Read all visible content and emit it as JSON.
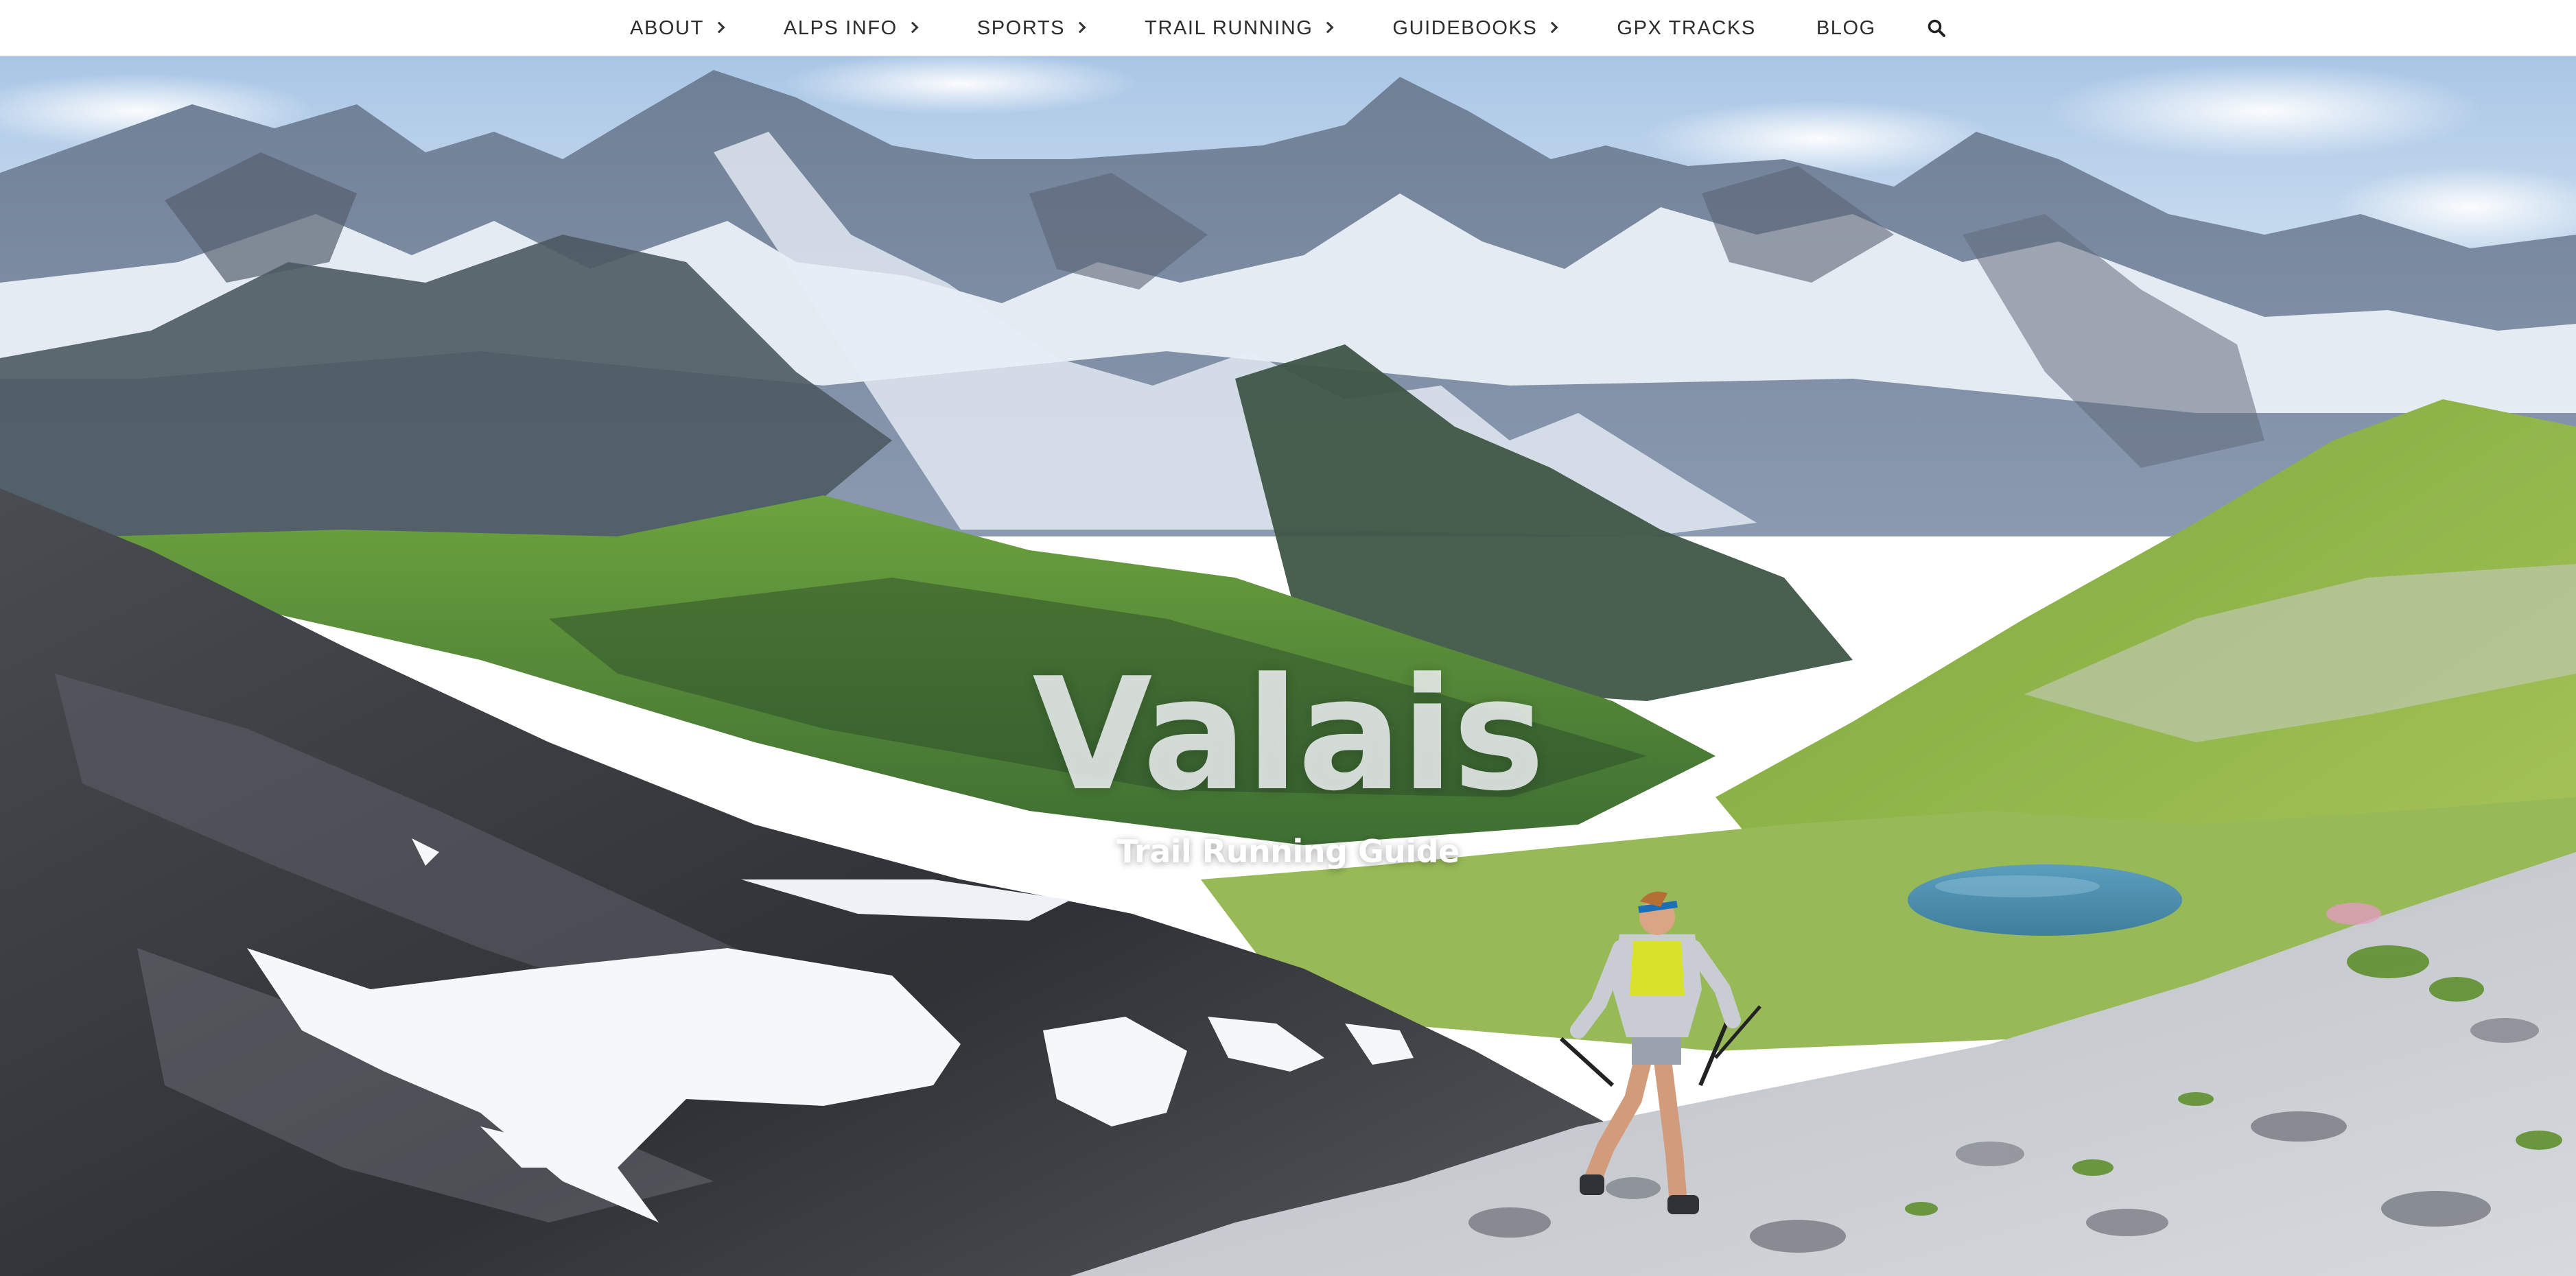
{
  "nav": {
    "items": [
      {
        "label": "ABOUT",
        "has_submenu": true
      },
      {
        "label": "ALPS INFO",
        "has_submenu": true
      },
      {
        "label": "SPORTS",
        "has_submenu": true
      },
      {
        "label": "TRAIL RUNNING",
        "has_submenu": true
      },
      {
        "label": "GUIDEBOOKS",
        "has_submenu": true
      },
      {
        "label": "GPX TRACKS",
        "has_submenu": false
      },
      {
        "label": "BLOG",
        "has_submenu": false
      }
    ],
    "search_icon": "search-icon",
    "text_color": "#2d2d2d",
    "background": "#ffffff"
  },
  "hero": {
    "title": "Valais",
    "subtitle": "Trail Running Guide",
    "image_subject": "trail-runner-alpine-scene-photo"
  },
  "colors": {
    "sky": "#c9dcef",
    "snow": "#f4f7fb",
    "rock_dark": "#3f4349",
    "meadow": "#5e9a37",
    "lake": "#4d8fb0"
  }
}
